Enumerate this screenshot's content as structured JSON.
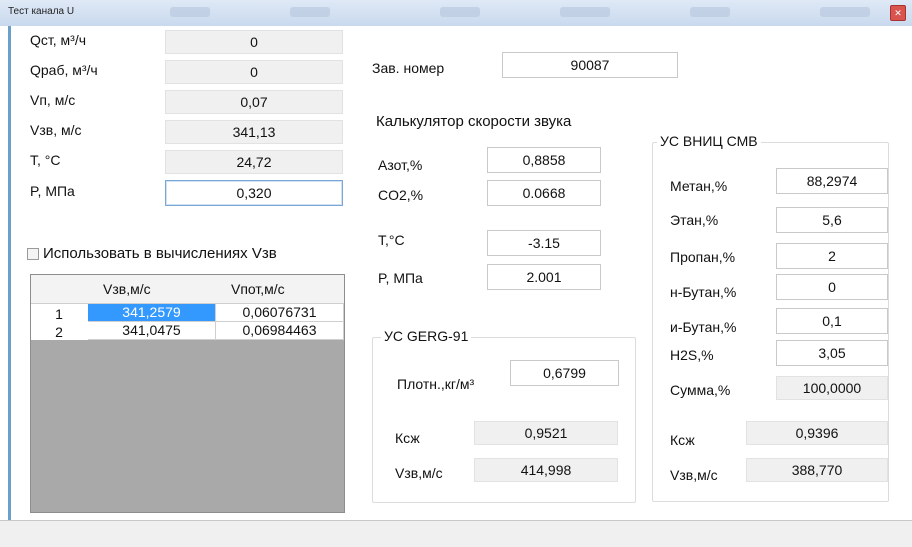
{
  "window": {
    "title": "Тест канала U"
  },
  "params": [
    {
      "label": "Qст, м³/ч",
      "value": "0"
    },
    {
      "label": "Qраб, м³/ч",
      "value": "0"
    },
    {
      "label": "Vп, м/с",
      "value": "0,07"
    },
    {
      "label": "Vзв, м/с",
      "value": "341,13"
    },
    {
      "label": "T, °C",
      "value": "24,72"
    },
    {
      "label": "P, МПа",
      "value": "0,320"
    }
  ],
  "use_checkbox": {
    "label": "Использовать в вычислениях Vзв",
    "checked": false
  },
  "grid": {
    "columns": [
      "Vзв,м/с",
      "Vпот,м/с"
    ],
    "rows": [
      {
        "num": "1",
        "vzv": "341,2579",
        "vpot": "0,06076731"
      },
      {
        "num": "2",
        "vzv": "341,0475",
        "vpot": "0,06984463"
      }
    ]
  },
  "serial": {
    "label": "Зав. номер",
    "value": "90087"
  },
  "calculator": {
    "title": "Калькулятор скорости звука",
    "inputs": [
      {
        "label": "Азот,%",
        "value": "0,8858"
      },
      {
        "label": "CO2,%",
        "value": "0.0668"
      },
      {
        "label": "T,°C",
        "value": "-3.15"
      },
      {
        "label": "P, МПа",
        "value": "2.001"
      }
    ]
  },
  "gerg": {
    "title": "УС GERG-91",
    "density": {
      "label": "Плотн.,кг/м³",
      "value": "0,6799"
    },
    "ksg": {
      "label": "Ксж",
      "value": "0,9521"
    },
    "vzv": {
      "label": "Vзв,м/с",
      "value": "414,998"
    }
  },
  "vnic": {
    "title": "УС ВНИЦ СМВ",
    "inputs": [
      {
        "label": "Метан,%",
        "value": "88,2974"
      },
      {
        "label": "Этан,%",
        "value": "5,6"
      },
      {
        "label": "Пропан,%",
        "value": "2"
      },
      {
        "label": "н-Бутан,%",
        "value": "0"
      },
      {
        "label": "и-Бутан,%",
        "value": "0,1"
      },
      {
        "label": "H2S,%",
        "value": "3,05"
      }
    ],
    "sum": {
      "label": "Сумма,%",
      "value": "100,0000"
    },
    "ksg": {
      "label": "Ксж",
      "value": "0,9396"
    },
    "vzv": {
      "label": "Vзв,м/с",
      "value": "388,770"
    }
  },
  "colors": {
    "accent": "#3399ff",
    "readonly_bg": "#f0f0f0",
    "grid_bg": "#a9a9a9"
  }
}
